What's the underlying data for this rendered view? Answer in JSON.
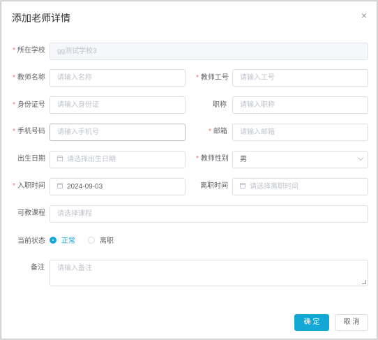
{
  "dialog": {
    "title": "添加老师详情",
    "close_glyph": "×"
  },
  "form": {
    "school": {
      "label": "所在学校",
      "required": "*",
      "value": "gg测试学校3"
    },
    "name": {
      "label": "教师名称",
      "required": "*",
      "placeholder": "请输入名称"
    },
    "job_no": {
      "label": "教师工号",
      "required": "*",
      "placeholder": "请输入工号"
    },
    "id_card": {
      "label": "身份证号",
      "required": "*",
      "placeholder": "请输入身份证"
    },
    "title": {
      "label": "职称",
      "placeholder": "请输入职称"
    },
    "phone": {
      "label": "手机号码",
      "required": "*",
      "placeholder": "请输入手机号"
    },
    "email": {
      "label": "邮箱",
      "required": "*",
      "placeholder": "请输入邮箱"
    },
    "birthday": {
      "label": "出生日期",
      "placeholder": "请选择出生日期"
    },
    "gender": {
      "label": "教师性别",
      "required": "*",
      "value": "男"
    },
    "hire_date": {
      "label": "入职时间",
      "required": "*",
      "value": "2024-09-03"
    },
    "leave_date": {
      "label": "离职时间",
      "placeholder": "请选择离职时间"
    },
    "courses": {
      "label": "可教课程",
      "placeholder": "请选择课程"
    },
    "status": {
      "label": "当前状态",
      "options": [
        "正常",
        "离职"
      ],
      "selected": "正常"
    },
    "remark": {
      "label": "备注",
      "placeholder": "请输入备注"
    }
  },
  "footer": {
    "confirm_label": "确 定",
    "cancel_label": "取 消"
  },
  "colors": {
    "primary": "#13a7d6",
    "required": "#f56c6c"
  }
}
